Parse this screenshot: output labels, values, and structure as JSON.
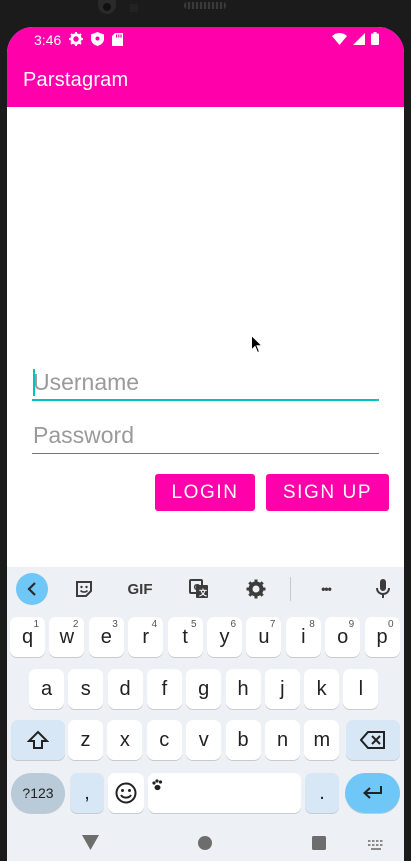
{
  "status_bar": {
    "time": "3:46",
    "left_icons": [
      "gear-icon",
      "shield-icon",
      "sd-card-icon"
    ],
    "right_icons": [
      "wifi-icon",
      "signal-icon",
      "battery-icon"
    ]
  },
  "app_bar": {
    "title": "Parstagram"
  },
  "login_form": {
    "username_placeholder": "Username",
    "username_value": "",
    "password_placeholder": "Password",
    "password_value": "",
    "login_label": "LOGIN",
    "signup_label": "SIGN UP"
  },
  "colors": {
    "accent": "#ff00aa",
    "focus": "#00c2c2",
    "keyboard_bg": "#edf0f5",
    "keyboard_highlight": "#6fc7f7"
  },
  "keyboard": {
    "toolbar": [
      "back-icon",
      "sticker-icon",
      "GIF",
      "translate-icon",
      "settings-icon",
      "more-icon",
      "mic-icon"
    ],
    "gif_label": "GIF",
    "more_label": "•••",
    "row1": [
      {
        "key": "q",
        "hint": "1"
      },
      {
        "key": "w",
        "hint": "2"
      },
      {
        "key": "e",
        "hint": "3"
      },
      {
        "key": "r",
        "hint": "4"
      },
      {
        "key": "t",
        "hint": "5"
      },
      {
        "key": "y",
        "hint": "6"
      },
      {
        "key": "u",
        "hint": "7"
      },
      {
        "key": "i",
        "hint": "8"
      },
      {
        "key": "o",
        "hint": "9"
      },
      {
        "key": "p",
        "hint": "0"
      }
    ],
    "row2": [
      "a",
      "s",
      "d",
      "f",
      "g",
      "h",
      "j",
      "k",
      "l"
    ],
    "row3": [
      "z",
      "x",
      "c",
      "v",
      "b",
      "n",
      "m"
    ],
    "symbols_label": "?123",
    "comma_label": ",",
    "period_label": "."
  },
  "nav_bar": [
    "back-triangle-icon",
    "home-circle-icon",
    "recents-square-icon",
    "keyboard-switch-icon"
  ]
}
